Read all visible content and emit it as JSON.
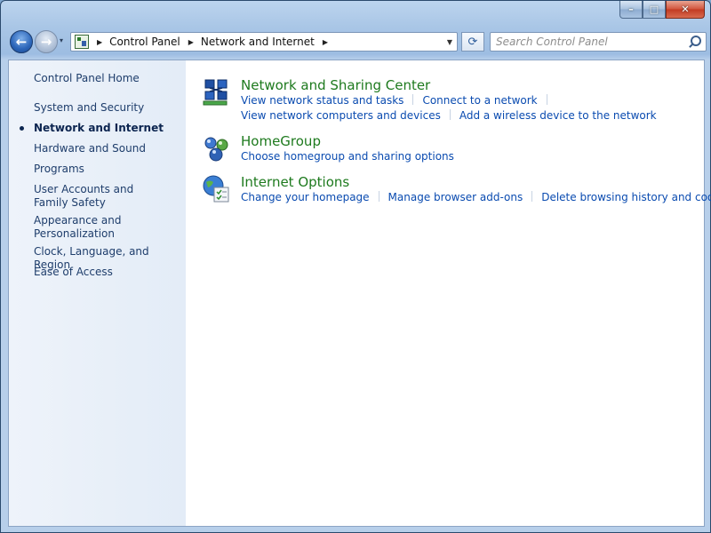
{
  "window": {
    "caption_buttons": {
      "minimize": "–",
      "maximize": "□",
      "close": "✕"
    }
  },
  "nav": {
    "back_glyph": "←",
    "forward_glyph": "→",
    "recent_glyph": "▾",
    "address": {
      "crumbs": [
        "Control Panel",
        "Network and Internet"
      ],
      "arrow_glyph": "▶",
      "dropdown_glyph": "▼"
    },
    "refresh_glyph": "⟳",
    "search": {
      "placeholder": "Search Control Panel"
    }
  },
  "sidebar": {
    "items": [
      {
        "label": "Control Panel Home"
      },
      {
        "label": "System and Security"
      },
      {
        "label": "Network and Internet",
        "selected": true
      },
      {
        "label": "Hardware and Sound"
      },
      {
        "label": "Programs"
      },
      {
        "label": "User Accounts and Family Safety"
      },
      {
        "label": "Appearance and Personalization"
      },
      {
        "label": "Clock, Language, and Region"
      },
      {
        "label": "Ease of Access"
      }
    ]
  },
  "categories": [
    {
      "title": "Network and Sharing Center",
      "icon": "network-sharing-icon",
      "links": [
        [
          "View network status and tasks",
          "Connect to a network"
        ],
        [
          "View network computers and devices",
          "Add a wireless device to the network"
        ]
      ]
    },
    {
      "title": "HomeGroup",
      "icon": "homegroup-icon",
      "links": [
        [
          "Choose homegroup and sharing options"
        ]
      ]
    },
    {
      "title": "Internet Options",
      "icon": "internet-options-icon",
      "links": [
        [
          "Change your homepage",
          "Manage browser add-ons",
          "Delete browsing history and cookies"
        ]
      ]
    }
  ],
  "colors": {
    "link": "#0a4bb0",
    "category_title": "#1e7a1e",
    "sidebar_text": "#1e3d6b",
    "sidebar_bg": "#e3ecf7"
  }
}
